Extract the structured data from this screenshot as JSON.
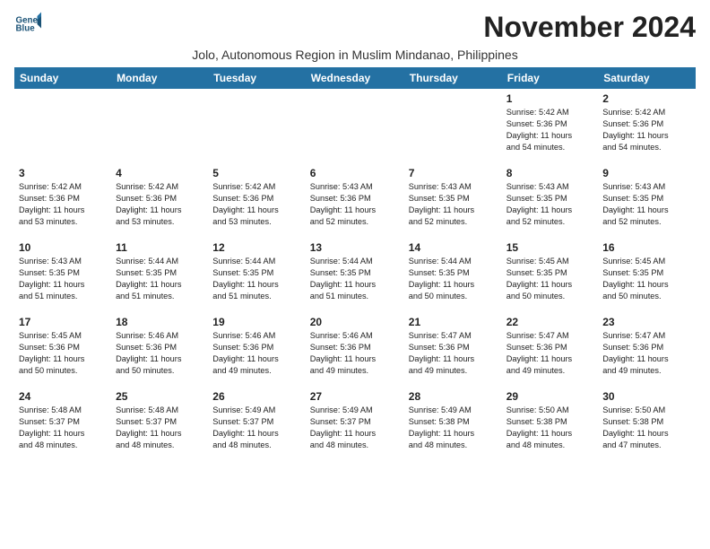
{
  "header": {
    "logo_line1": "General",
    "logo_line2": "Blue",
    "month_title": "November 2024",
    "subtitle": "Jolo, Autonomous Region in Muslim Mindanao, Philippines"
  },
  "days_of_week": [
    "Sunday",
    "Monday",
    "Tuesday",
    "Wednesday",
    "Thursday",
    "Friday",
    "Saturday"
  ],
  "weeks": [
    {
      "days": [
        {
          "num": "",
          "info": ""
        },
        {
          "num": "",
          "info": ""
        },
        {
          "num": "",
          "info": ""
        },
        {
          "num": "",
          "info": ""
        },
        {
          "num": "",
          "info": ""
        },
        {
          "num": "1",
          "info": "Sunrise: 5:42 AM\nSunset: 5:36 PM\nDaylight: 11 hours\nand 54 minutes."
        },
        {
          "num": "2",
          "info": "Sunrise: 5:42 AM\nSunset: 5:36 PM\nDaylight: 11 hours\nand 54 minutes."
        }
      ]
    },
    {
      "days": [
        {
          "num": "3",
          "info": "Sunrise: 5:42 AM\nSunset: 5:36 PM\nDaylight: 11 hours\nand 53 minutes."
        },
        {
          "num": "4",
          "info": "Sunrise: 5:42 AM\nSunset: 5:36 PM\nDaylight: 11 hours\nand 53 minutes."
        },
        {
          "num": "5",
          "info": "Sunrise: 5:42 AM\nSunset: 5:36 PM\nDaylight: 11 hours\nand 53 minutes."
        },
        {
          "num": "6",
          "info": "Sunrise: 5:43 AM\nSunset: 5:36 PM\nDaylight: 11 hours\nand 52 minutes."
        },
        {
          "num": "7",
          "info": "Sunrise: 5:43 AM\nSunset: 5:35 PM\nDaylight: 11 hours\nand 52 minutes."
        },
        {
          "num": "8",
          "info": "Sunrise: 5:43 AM\nSunset: 5:35 PM\nDaylight: 11 hours\nand 52 minutes."
        },
        {
          "num": "9",
          "info": "Sunrise: 5:43 AM\nSunset: 5:35 PM\nDaylight: 11 hours\nand 52 minutes."
        }
      ]
    },
    {
      "days": [
        {
          "num": "10",
          "info": "Sunrise: 5:43 AM\nSunset: 5:35 PM\nDaylight: 11 hours\nand 51 minutes."
        },
        {
          "num": "11",
          "info": "Sunrise: 5:44 AM\nSunset: 5:35 PM\nDaylight: 11 hours\nand 51 minutes."
        },
        {
          "num": "12",
          "info": "Sunrise: 5:44 AM\nSunset: 5:35 PM\nDaylight: 11 hours\nand 51 minutes."
        },
        {
          "num": "13",
          "info": "Sunrise: 5:44 AM\nSunset: 5:35 PM\nDaylight: 11 hours\nand 51 minutes."
        },
        {
          "num": "14",
          "info": "Sunrise: 5:44 AM\nSunset: 5:35 PM\nDaylight: 11 hours\nand 50 minutes."
        },
        {
          "num": "15",
          "info": "Sunrise: 5:45 AM\nSunset: 5:35 PM\nDaylight: 11 hours\nand 50 minutes."
        },
        {
          "num": "16",
          "info": "Sunrise: 5:45 AM\nSunset: 5:35 PM\nDaylight: 11 hours\nand 50 minutes."
        }
      ]
    },
    {
      "days": [
        {
          "num": "17",
          "info": "Sunrise: 5:45 AM\nSunset: 5:36 PM\nDaylight: 11 hours\nand 50 minutes."
        },
        {
          "num": "18",
          "info": "Sunrise: 5:46 AM\nSunset: 5:36 PM\nDaylight: 11 hours\nand 50 minutes."
        },
        {
          "num": "19",
          "info": "Sunrise: 5:46 AM\nSunset: 5:36 PM\nDaylight: 11 hours\nand 49 minutes."
        },
        {
          "num": "20",
          "info": "Sunrise: 5:46 AM\nSunset: 5:36 PM\nDaylight: 11 hours\nand 49 minutes."
        },
        {
          "num": "21",
          "info": "Sunrise: 5:47 AM\nSunset: 5:36 PM\nDaylight: 11 hours\nand 49 minutes."
        },
        {
          "num": "22",
          "info": "Sunrise: 5:47 AM\nSunset: 5:36 PM\nDaylight: 11 hours\nand 49 minutes."
        },
        {
          "num": "23",
          "info": "Sunrise: 5:47 AM\nSunset: 5:36 PM\nDaylight: 11 hours\nand 49 minutes."
        }
      ]
    },
    {
      "days": [
        {
          "num": "24",
          "info": "Sunrise: 5:48 AM\nSunset: 5:37 PM\nDaylight: 11 hours\nand 48 minutes."
        },
        {
          "num": "25",
          "info": "Sunrise: 5:48 AM\nSunset: 5:37 PM\nDaylight: 11 hours\nand 48 minutes."
        },
        {
          "num": "26",
          "info": "Sunrise: 5:49 AM\nSunset: 5:37 PM\nDaylight: 11 hours\nand 48 minutes."
        },
        {
          "num": "27",
          "info": "Sunrise: 5:49 AM\nSunset: 5:37 PM\nDaylight: 11 hours\nand 48 minutes."
        },
        {
          "num": "28",
          "info": "Sunrise: 5:49 AM\nSunset: 5:38 PM\nDaylight: 11 hours\nand 48 minutes."
        },
        {
          "num": "29",
          "info": "Sunrise: 5:50 AM\nSunset: 5:38 PM\nDaylight: 11 hours\nand 48 minutes."
        },
        {
          "num": "30",
          "info": "Sunrise: 5:50 AM\nSunset: 5:38 PM\nDaylight: 11 hours\nand 47 minutes."
        }
      ]
    }
  ]
}
